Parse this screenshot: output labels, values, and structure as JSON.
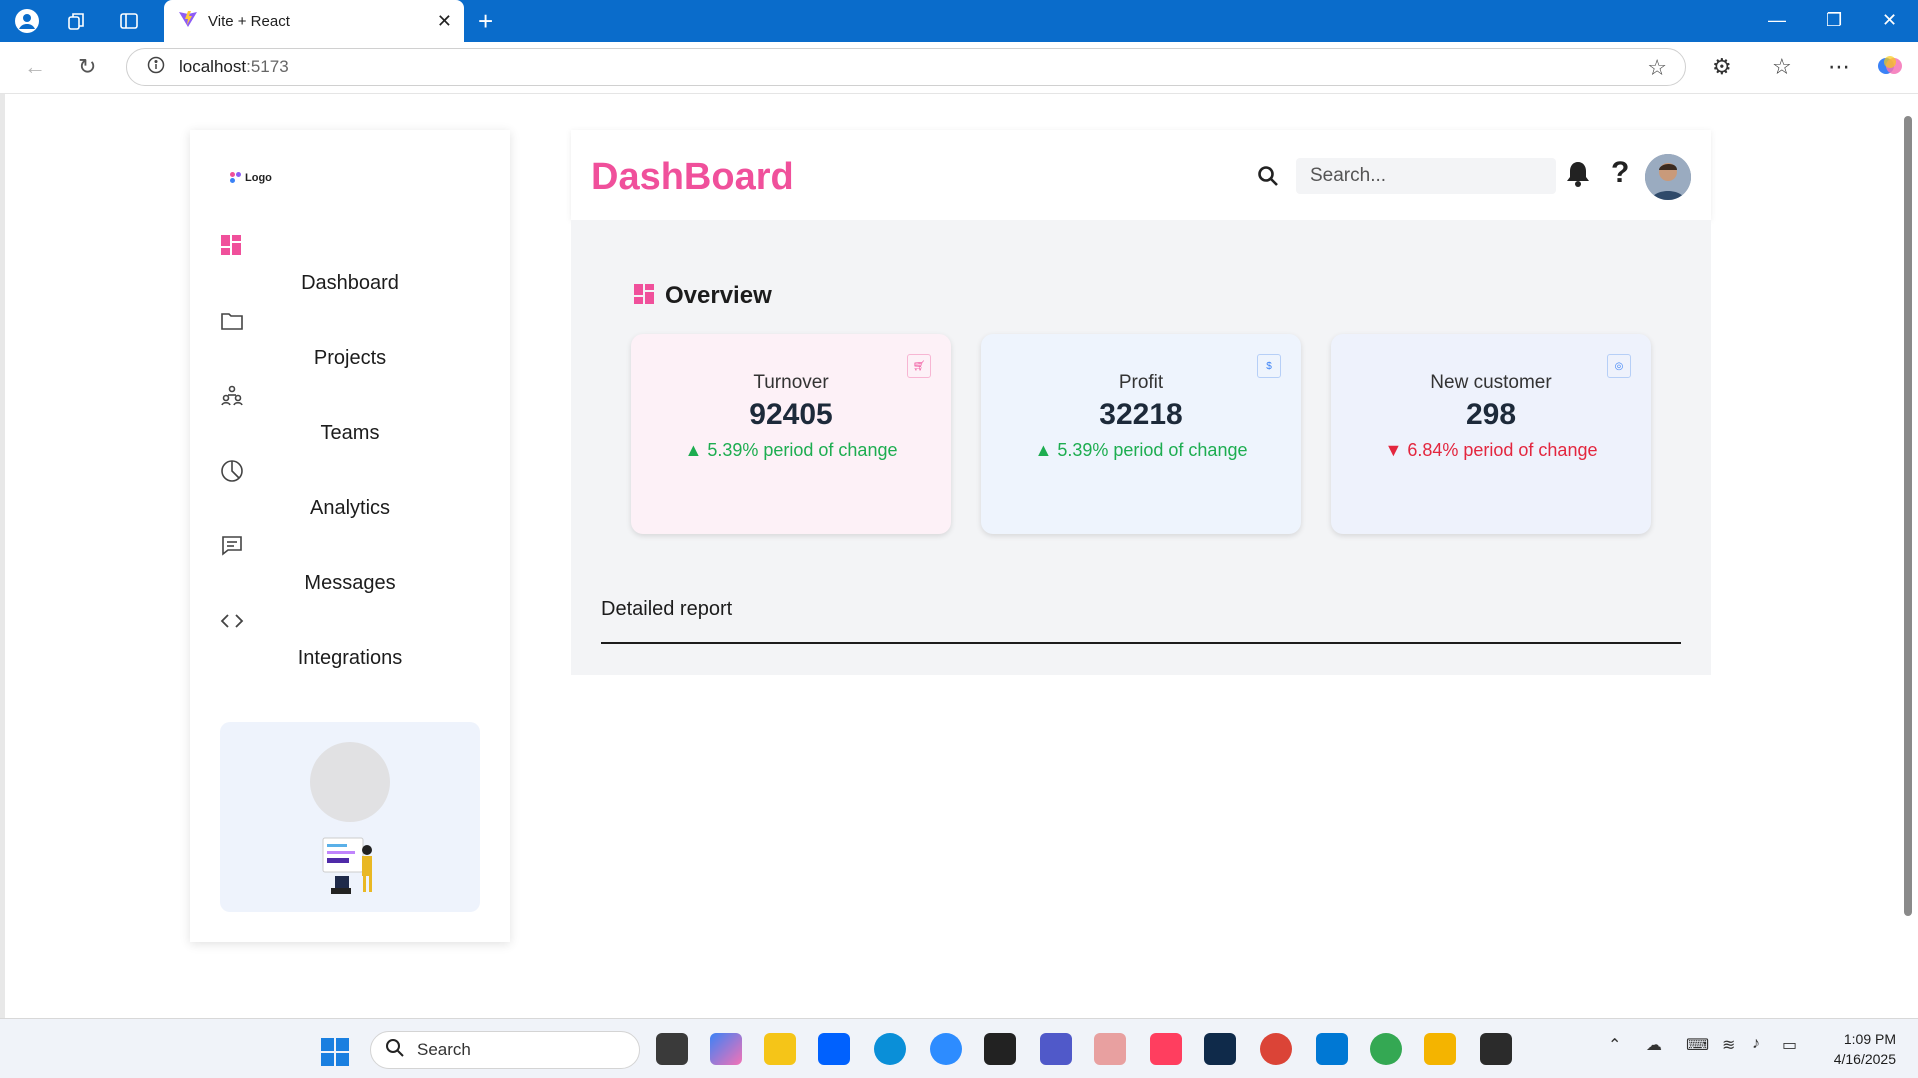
{
  "browser": {
    "tab_title": "Vite + React",
    "url_host": "localhost",
    "url_port": ":5173"
  },
  "sidebar": {
    "logo_text": "Logo",
    "items": [
      {
        "label": "Dashboard",
        "icon": "dashboard-grid-icon",
        "active": true
      },
      {
        "label": "Projects",
        "icon": "folder-icon"
      },
      {
        "label": "Teams",
        "icon": "teams-icon"
      },
      {
        "label": "Analytics",
        "icon": "pie-chart-icon"
      },
      {
        "label": "Messages",
        "icon": "message-icon"
      },
      {
        "label": "Integrations",
        "icon": "code-icon"
      }
    ]
  },
  "header": {
    "title": "DashBoard",
    "search_placeholder": "Search..."
  },
  "overview": {
    "title": "Overview",
    "cards": [
      {
        "title": "Turnover",
        "value": "92405",
        "change": "5.39% period of change",
        "trend": "up",
        "icon": "cart-icon",
        "bg": "#fdf1f7",
        "badge_color": "#f0509b"
      },
      {
        "title": "Profit",
        "value": "32218",
        "change": "5.39% period of change",
        "trend": "up",
        "icon": "dollar-icon",
        "bg": "#eef4fd",
        "badge_color": "#3b82f6"
      },
      {
        "title": "New customer",
        "value": "298",
        "change": "6.84% period of change",
        "trend": "down",
        "icon": "customer-icon",
        "bg": "#eef2fc",
        "badge_color": "#3b82f6"
      }
    ]
  },
  "report": {
    "title": "Detailed report"
  },
  "taskbar": {
    "search_label": "Search",
    "time": "1:09 PM",
    "date": "4/16/2025"
  },
  "colors": {
    "accent_pink": "#f0509b",
    "up_green": "#1dad50",
    "down_red": "#e3263e",
    "browser_blue": "#0a6ccb"
  }
}
